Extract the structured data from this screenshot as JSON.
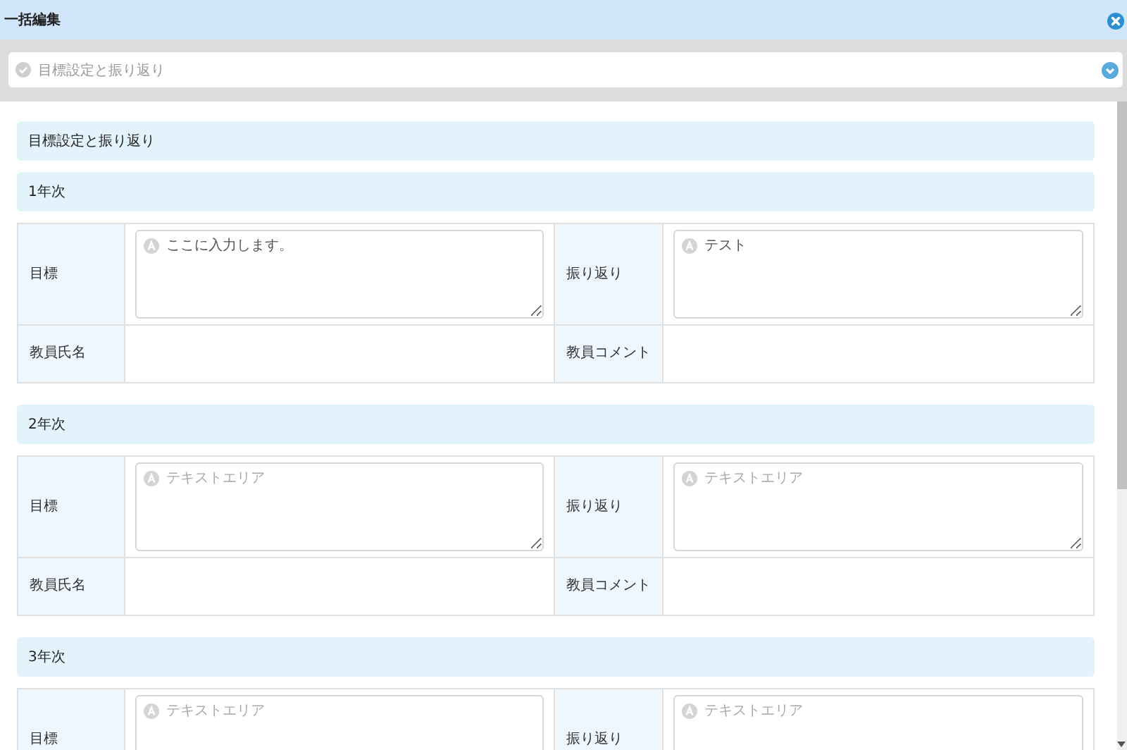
{
  "dialog": {
    "title": "一括編集"
  },
  "selector": {
    "value": "目標設定と振り返り"
  },
  "section_title": "目標設定と振り返り",
  "years": [
    {
      "title": "1年次",
      "rows": [
        {
          "cells": [
            {
              "kind": "label",
              "text": "目標"
            },
            {
              "kind": "textarea",
              "value": "ここに入力します。"
            },
            {
              "kind": "label",
              "text": "振り返り"
            },
            {
              "kind": "textarea",
              "value": "テスト"
            }
          ]
        },
        {
          "cells": [
            {
              "kind": "label",
              "text": "教員氏名"
            },
            {
              "kind": "empty"
            },
            {
              "kind": "label",
              "text": "教員コメント"
            },
            {
              "kind": "empty"
            }
          ]
        }
      ]
    },
    {
      "title": "2年次",
      "rows": [
        {
          "cells": [
            {
              "kind": "label",
              "text": "目標"
            },
            {
              "kind": "textarea",
              "placeholder": "テキストエリア"
            },
            {
              "kind": "label",
              "text": "振り返り"
            },
            {
              "kind": "textarea",
              "placeholder": "テキストエリア"
            }
          ]
        },
        {
          "cells": [
            {
              "kind": "label",
              "text": "教員氏名"
            },
            {
              "kind": "empty"
            },
            {
              "kind": "label",
              "text": "教員コメント"
            },
            {
              "kind": "empty"
            }
          ]
        }
      ]
    },
    {
      "title": "3年次",
      "rows": [
        {
          "cells": [
            {
              "kind": "label",
              "text": "目標"
            },
            {
              "kind": "textarea",
              "placeholder": "テキストエリア"
            },
            {
              "kind": "label",
              "text": "振り返り"
            },
            {
              "kind": "textarea",
              "placeholder": "テキストエリア"
            }
          ]
        }
      ]
    }
  ]
}
